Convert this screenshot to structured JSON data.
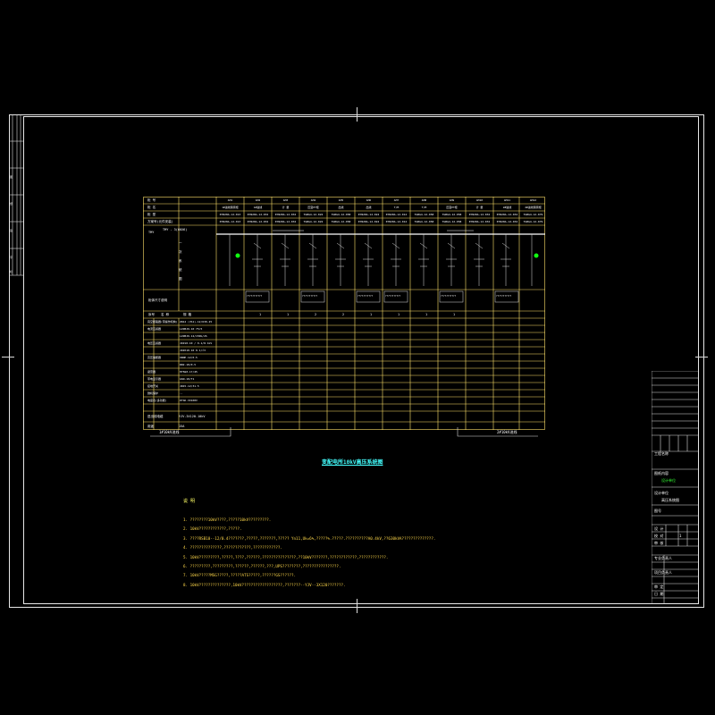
{
  "drawing": {
    "title": "变配电所10kV高压系统图",
    "notes_title": "说 明",
    "notes": [
      "1. ????????10kV????,?????10kV?????????.",
      "2. 10kV????????????,?????.",
      "3. ????RSB10--12/0.4???????,?????,???????,?????  Yn11,Uk=6%,?????%.?????.??????????A0.4kV,??630kVA??????????????.",
      "4. ??????????????,????????????,????????????.",
      "5. 10kV?????????,?????,????,??????,???????????????,??10kV???????,????????????,????????????.",
      "6. ?????????,?????????,??????,??????,???,UPS????????,????????????????.",
      "7. 10kV?????MSG?????,?????ATS?????,??????GS??????.",
      "8. 10kV??????????????,10kV??????????????????,???????--YJV--3X120???????."
    ]
  },
  "table": {
    "row_header": [
      "柜 号",
      "柜 名",
      "柜 型",
      "方案号(元件安装)"
    ],
    "columns": [
      {
        "no": "AH1",
        "name": "1#进线隔离柜",
        "model": "KYN28A-12-013",
        "scheme": "KYN28A-12-013"
      },
      {
        "no": "AH2",
        "name": "1#进线",
        "model": "KYN28A-12-032",
        "scheme": "KYN28A-12-032"
      },
      {
        "no": "AH3",
        "name": "计 量",
        "model": "KYN28A-12-032",
        "scheme": "KYN28A-12-032"
      },
      {
        "no": "AH4",
        "name": "压变PT柜",
        "model": "TGBG4-12-022",
        "scheme": "TGBG4-12-022"
      },
      {
        "no": "AH5",
        "name": "出线",
        "model": "TGBG4-12-058",
        "scheme": "TGBG4-12-058"
      },
      {
        "no": "AH6",
        "name": "出线",
        "model": "KYN28A-12-024",
        "scheme": "KYN28A-12-024"
      },
      {
        "no": "AH7",
        "name": "T/M",
        "model": "KYN28A-12-012",
        "scheme": "KYN28A-12-012"
      },
      {
        "no": "AH8",
        "name": "T/M",
        "model": "TGBG4-12-058",
        "scheme": "TGBG4-12-058"
      },
      {
        "no": "AH9",
        "name": "压变PT柜",
        "model": "TGBG4-12-058",
        "scheme": "TGBG4-12-058"
      },
      {
        "no": "AH10",
        "name": "计 量",
        "model": "KYN28A-12-032",
        "scheme": "KYN28A-12-032"
      },
      {
        "no": "AH11",
        "name": "2#进线",
        "model": "KYN28A-12-032",
        "scheme": "KYN28A-12-032"
      },
      {
        "no": "AH12",
        "name": "2#进线隔离柜",
        "model": "TGBG4-12-079",
        "scheme": "TGBG4-12-079"
      }
    ],
    "bus_label": "TMY - 3(60X6)",
    "left_section_labels": [
      "TMY",
      "一",
      "次",
      "系",
      "统",
      "图"
    ],
    "desc_label": "柜体尺寸说明",
    "desc_boxes": [
      "???????????",
      "???????????",
      "???????????",
      "???????????",
      "???????????",
      "???????????"
    ],
    "count_row_header": [
      "序号",
      "名 称",
      "规 格"
    ],
    "count_values": [
      "1",
      "1",
      "2",
      "2",
      "1",
      "1",
      "1",
      "1"
    ],
    "component_rows": [
      {
        "name": "真空断路器(带操作机构)",
        "spec": "ZN12 (VS1)-12/630-25"
      },
      {
        "name": "电流互感器",
        "spec": "LZZBJ9-10 75/5"
      },
      {
        "name": "",
        "spec": "LZZBJ9-12/150b/2S"
      },
      {
        "name": "电压互感器",
        "spec": "JDZ10-10 / 0.1/0.1kV"
      },
      {
        "name": "",
        "spec": "JDZX10-10 0.1/√3"
      },
      {
        "name": "高压熔断器",
        "spec": "XRNP-12/0.5"
      },
      {
        "name": "",
        "spec": "RN2-10/0.5"
      },
      {
        "name": "避雷器",
        "spec": "HY5WZ-17/45"
      },
      {
        "name": "带电显示器",
        "spec": "GSN-10/T1"
      },
      {
        "name": "接地开关",
        "spec": "JN15-12/31.5"
      },
      {
        "name": "微机保护",
        "spec": "--"
      },
      {
        "name": "电度表(多功能)",
        "spec": "DTSD-3X100V"
      }
    ],
    "bottom_rows": [
      {
        "name": "进出线电缆",
        "spec": "YJV-3X120-10kV"
      },
      {
        "name": "用途",
        "spec": "15A"
      }
    ],
    "left_feed": "1#10kV进线",
    "right_feed": "2#10kV进线"
  },
  "title_block": {
    "rows": [
      "工程名称",
      "图纸内容",
      "设计单位",
      "图号"
    ],
    "project": "工程名称",
    "content": "高压系统图",
    "green_text": "设计单位",
    "labels_a": [
      "设 计",
      "校 对",
      "审 核"
    ],
    "labels_b": [
      "专业负责人",
      "项目负责人",
      "审 定",
      "日 期"
    ],
    "sheet": "1"
  },
  "left_strip_labels": [
    "图",
    "纸",
    "签",
    "字",
    "栏"
  ]
}
